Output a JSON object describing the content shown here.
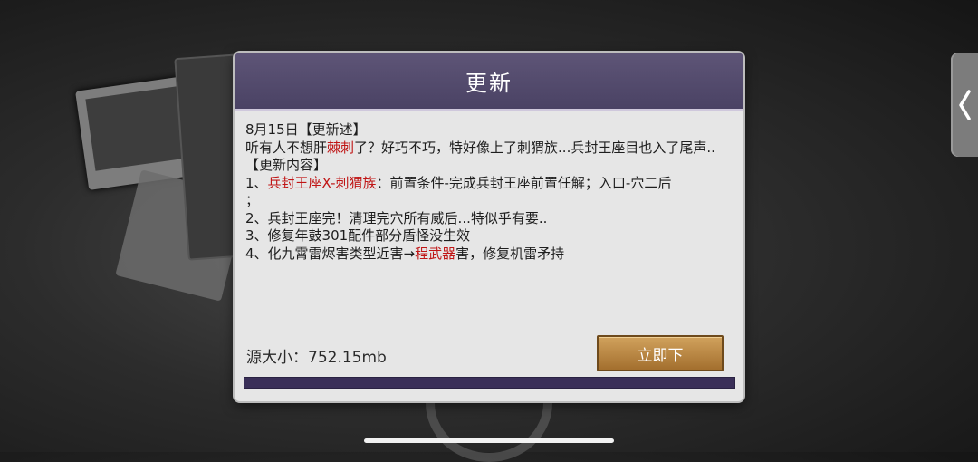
{
  "dialog": {
    "title": "更新",
    "date_header": "8月15日【更新述】",
    "intro": {
      "part1": "听有人不想肝",
      "highlight": "棘刺",
      "part2": "了？好巧不巧，特好像上了刺猬族...兵封王座目也入了尾声.."
    },
    "section_header": "【更新内容】",
    "items": {
      "item1_prefix": "1、",
      "item1_highlight": "兵封王座X-刺猬族",
      "item1_rest": "：前置条件-完成兵封王座前置任解；入口-穴二后",
      "item1_semicolon": "；",
      "item2": "2、兵封王座完！清理完穴所有威后...特似乎有要..",
      "item3": "3、修复年鼓301配件部分盾怪没生效",
      "item4_prefix": "4、化九霄雷烬害类型近害→",
      "item4_highlight": "程武器",
      "item4_rest": "害，修复机雷矛持"
    },
    "size_label": "源大小：752.15mb",
    "download_button": "立即下",
    "progress": 0
  },
  "side_tab": {
    "icon": "chevron-left-icon"
  },
  "colors": {
    "header": "#4f4769",
    "highlight": "#c01515",
    "button": "#b8843f",
    "progress_track": "#3a2f58"
  }
}
